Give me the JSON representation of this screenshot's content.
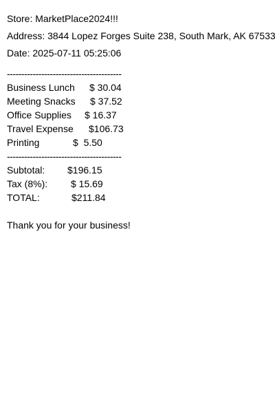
{
  "store": "Store: MarketPlace2024!!!",
  "address": "Address: 3844 Lopez Forges Suite 238, South Mark, AK 67533",
  "date": "Date: 2025-07-11 05:25:06",
  "separator": "----------------------------------------",
  "items": [
    {
      "name": "Business Lunch",
      "price": "$ 30.04"
    },
    {
      "name": "Meeting Snacks",
      "price": "$ 37.52"
    },
    {
      "name": "Office Supplies",
      "price": "$ 16.37"
    },
    {
      "name": "Travel Expense",
      "price": "$106.73"
    },
    {
      "name": "Printing",
      "price": "$  5.50"
    }
  ],
  "totals": {
    "subtotal_label": "Subtotal:",
    "subtotal_value": "$196.15",
    "tax_label": "Tax (8%):",
    "tax_value": "$ 15.69",
    "total_label": "TOTAL:",
    "total_value": "$211.84"
  },
  "footer": "Thank you for your business!"
}
